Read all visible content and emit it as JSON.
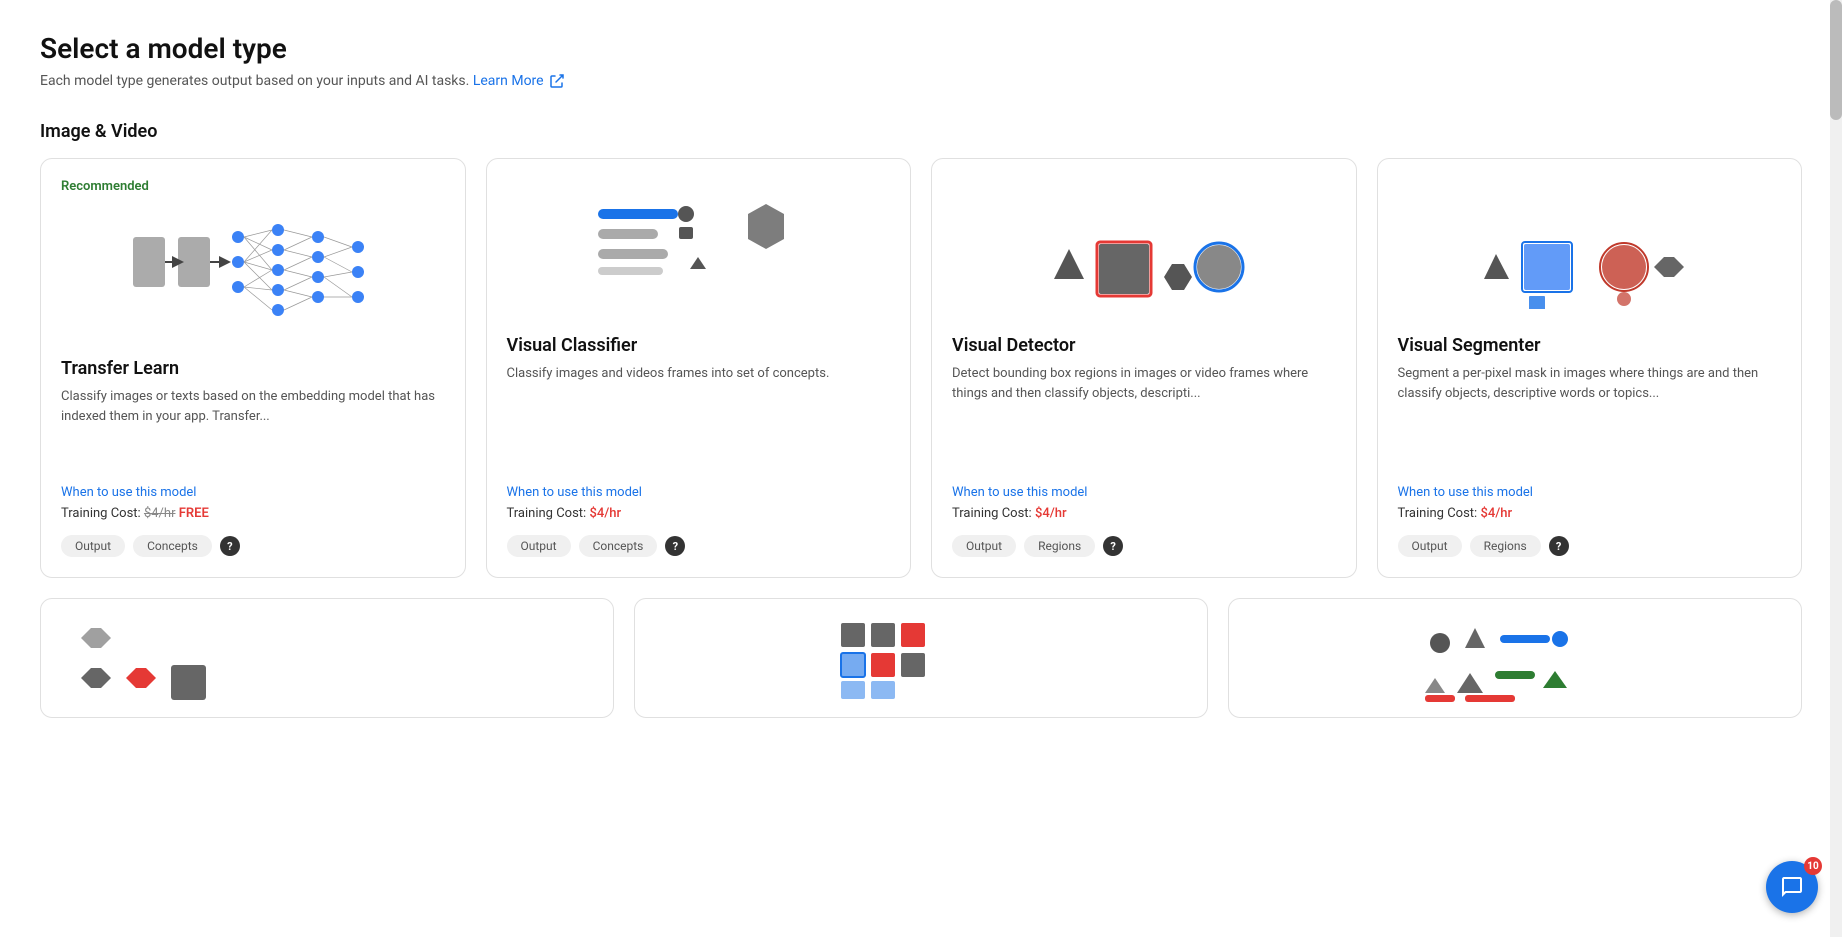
{
  "page": {
    "title": "Select a model type",
    "subtitle": "Each model type generates output based on your inputs and AI tasks.",
    "learn_more": "Learn More"
  },
  "section": {
    "title": "Image & Video"
  },
  "cards": [
    {
      "id": "transfer-learn",
      "recommended": "Recommended",
      "title": "Transfer Learn",
      "description": "Classify images or texts based on the embedding model that has indexed them in your app. Transfer...",
      "when_to_use": "When to use this model",
      "training_cost_label": "Training Cost:",
      "training_cost_original": "$4/hr",
      "training_cost_value": "FREE",
      "output_label": "Output",
      "tag1": "Concepts",
      "has_help": true
    },
    {
      "id": "visual-classifier",
      "recommended": null,
      "title": "Visual Classifier",
      "description": "Classify images and videos frames into set of concepts.",
      "when_to_use": "When to use this model",
      "training_cost_label": "Training Cost:",
      "training_cost_value": "$4/hr",
      "output_label": "Output",
      "tag1": "Concepts",
      "has_help": true
    },
    {
      "id": "visual-detector",
      "recommended": null,
      "title": "Visual Detector",
      "description": "Detect bounding box regions in images or video frames where things and then classify objects, descripti...",
      "when_to_use": "When to use this model",
      "training_cost_label": "Training Cost:",
      "training_cost_value": "$4/hr",
      "output_label": "Output",
      "tag1": "Regions",
      "has_help": true
    },
    {
      "id": "visual-segmenter",
      "recommended": null,
      "title": "Visual Segmenter",
      "description": "Segment a per-pixel mask in images where things are and then classify objects, descriptive words or topics...",
      "when_to_use": "When to use this model",
      "training_cost_label": "Training Cost:",
      "training_cost_value": "$4/hr",
      "output_label": "Output",
      "tag1": "Regions",
      "has_help": true
    }
  ],
  "chat": {
    "badge": "10"
  }
}
